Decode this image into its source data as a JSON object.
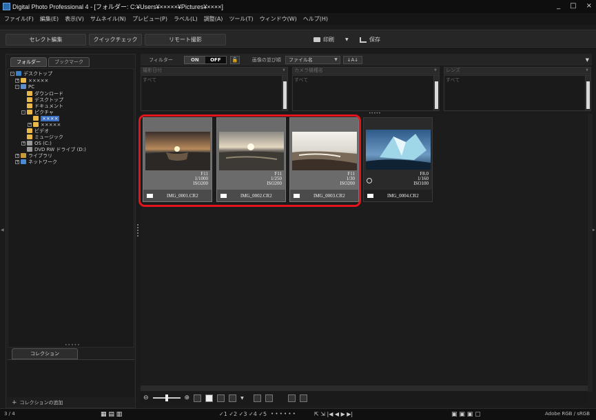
{
  "window": {
    "title": "Digital Photo Professional 4 - [フォルダー: C:¥Users¥×××××¥Pictures¥××××]",
    "minimize": "_",
    "maximize": "□",
    "close": "×"
  },
  "menu": [
    "ファイル(F)",
    "編集(E)",
    "表示(V)",
    "サムネイル(N)",
    "プレビュー(P)",
    "ラベル(L)",
    "調整(A)",
    "ツール(T)",
    "ウィンドウ(W)",
    "ヘルプ(H)"
  ],
  "toolbar": {
    "select_edit": "セレクト編集",
    "quick_check": "クイックチェック",
    "remote": "リモート撮影",
    "print": "印刷",
    "save": "保存"
  },
  "left_panel": {
    "tabs": [
      "フォルダー",
      "ブックマーク"
    ],
    "tree": [
      {
        "label": "デスクトップ",
        "icon": "desktop-icon"
      },
      {
        "label": "×××××",
        "icon": "folder-icon"
      },
      {
        "label": "PC",
        "icon": "pc-icon"
      },
      {
        "label": "ダウンロード",
        "icon": "folder-icon"
      },
      {
        "label": "デスクトップ",
        "icon": "folder-icon"
      },
      {
        "label": "ドキュメント",
        "icon": "folder-icon"
      },
      {
        "label": "ピクチャ",
        "icon": "folder-icon"
      },
      {
        "label": "××××",
        "icon": "folder-icon"
      },
      {
        "label": "×××××",
        "icon": "folder-icon"
      },
      {
        "label": "ビデオ",
        "icon": "folder-icon"
      },
      {
        "label": "ミュージック",
        "icon": "folder-icon"
      },
      {
        "label": "OS (C:)",
        "icon": "drive-icon"
      },
      {
        "label": "DVD RW ドライブ (D:)",
        "icon": "dvd-drive-icon"
      },
      {
        "label": "ライブラリ",
        "icon": "library-icon"
      },
      {
        "label": "ネットワーク",
        "icon": "network-icon"
      }
    ],
    "collection_tab": "コレクション",
    "add_collection": "コレクションの追加"
  },
  "filter": {
    "label": "フィルター",
    "on": "ON",
    "off": "OFF",
    "sort_label": "画像の並び順",
    "sort_value": "ファイル名",
    "sort_order": "↓A↓",
    "columns": [
      {
        "head": "撮影日付",
        "item": "すべて"
      },
      {
        "head": "カメラ機種名",
        "item": "すべて"
      },
      {
        "head": "レンズ",
        "item": "すべて"
      }
    ]
  },
  "thumbnails": [
    {
      "filename": "IMG_0001.CR2",
      "aperture": "F11",
      "shutter": "1/1000",
      "iso": "ISO200"
    },
    {
      "filename": "IMG_0002.CR2",
      "aperture": "F11",
      "shutter": "1/250",
      "iso": "ISO200"
    },
    {
      "filename": "IMG_0003.CR2",
      "aperture": "F11",
      "shutter": "1/30",
      "iso": "ISO200"
    },
    {
      "filename": "IMG_0004.CR2",
      "aperture": "F8.0",
      "shutter": "1/160",
      "iso": "ISO100"
    }
  ],
  "controls": {
    "checkmarks": "✓1 ✓2 ✓3 ✓4 ✓5",
    "dots": "• • • • • •"
  },
  "status": {
    "count": "3 / 4",
    "color_space": "Adobe RGB / sRGB"
  },
  "colors": {
    "highlight": "#e5141c",
    "selection": "#3a6fc4"
  }
}
